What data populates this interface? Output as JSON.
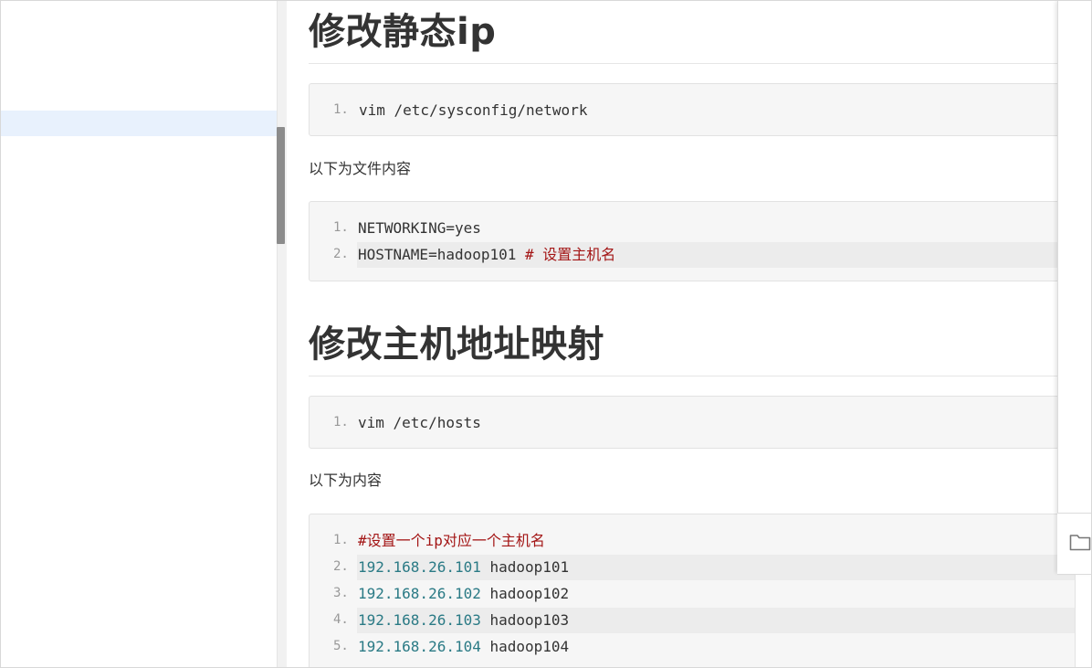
{
  "article": {
    "section1": {
      "heading": "修改静态ip",
      "code1": [
        {
          "n": "1.",
          "text": " vim /etc/sysconfig/network"
        }
      ],
      "paragraph": "以下为文件内容",
      "code2": [
        {
          "n": "1.",
          "text": "NETWORKING=yes"
        },
        {
          "n": "2.",
          "text": "HOSTNAME=hadoop101 ",
          "comment": "# 设置主机名"
        }
      ]
    },
    "section2": {
      "heading": "修改主机地址映射",
      "code1": [
        {
          "n": "1.",
          "text": "vim /etc/hosts"
        }
      ],
      "paragraph": "以下为内容",
      "code2": [
        {
          "n": "1.",
          "comment": "#设置一个ip对应一个主机名"
        },
        {
          "n": "2.",
          "ip": "192.168.26.101",
          "host": " hadoop101"
        },
        {
          "n": "3.",
          "ip": "192.168.26.102",
          "host": " hadoop102"
        },
        {
          "n": "4.",
          "ip": "192.168.26.103",
          "host": " hadoop103"
        },
        {
          "n": "5.",
          "ip": "192.168.26.104",
          "host": " hadoop104"
        }
      ]
    }
  },
  "right_panel": {
    "icon": "folder-icon"
  },
  "colors": {
    "comment": "#a31515",
    "ip": "#2a7a85",
    "sidebar_active": "#e8f1fd"
  }
}
